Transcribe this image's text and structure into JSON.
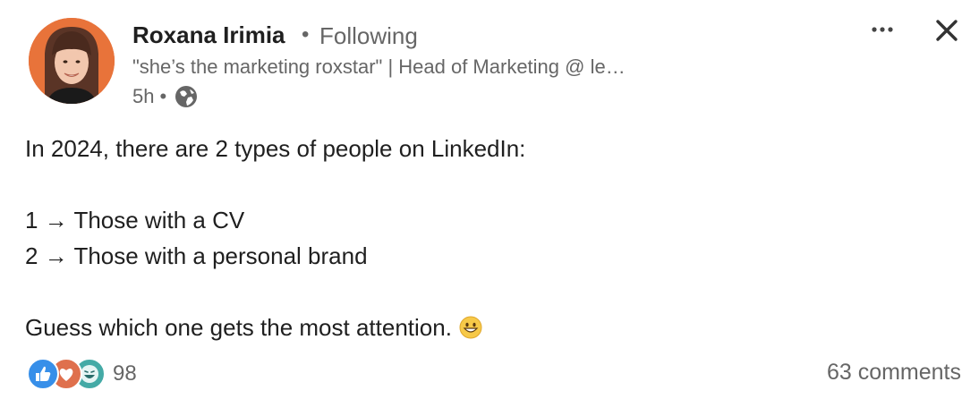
{
  "author": {
    "name": "Roxana Irimia",
    "follow_status": "Following",
    "separator": "•",
    "headline": "\"she’s the marketing roxstar\" | Head of Marketing @ le…",
    "time_ago": "5h",
    "time_separator": "•",
    "visibility_icon": "globe-icon",
    "avatar_bg": "#e8733a"
  },
  "controls": {
    "more_icon": "more-icon",
    "close_icon": "close-icon"
  },
  "post": {
    "line1": "In 2024, there are 2 types of people on LinkedIn:",
    "line2": "1 → Those with a CV",
    "line3": "2 → Those with a personal brand",
    "line4": "Guess which one gets the most attention.",
    "emoji": "grinning-face-emoji"
  },
  "social": {
    "reaction_icons": [
      "like-icon",
      "love-icon",
      "funny-icon"
    ],
    "reaction_count": "98",
    "comments": "63 comments"
  },
  "colors": {
    "text_primary": "#1f1f1f",
    "text_secondary": "#666666",
    "like_blue": "#378fe9",
    "love_red": "#df704d",
    "funny_teal": "#44aaa6"
  }
}
